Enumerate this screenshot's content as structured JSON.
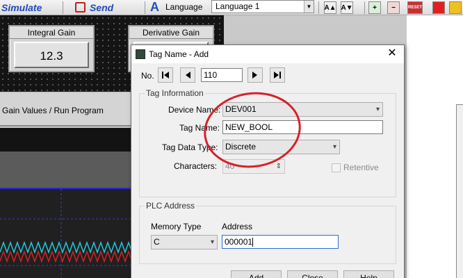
{
  "toolbar": {
    "simulate_label": "Simulate",
    "send_label": "Send",
    "language_label": "Language",
    "language_value": "Language 1",
    "reset_label": "RESET"
  },
  "background": {
    "integral_gain_title": "Integral Gain",
    "integral_gain_value": "12.3",
    "derivative_gain_title": "Derivative Gain",
    "nav_text": "Gain Values  /  Run Program"
  },
  "dialog": {
    "title": "Tag Name - Add",
    "no_label": "No.",
    "no_value": "110",
    "tag_info_title": "Tag Information",
    "device_name_label": "Device Name:",
    "device_name_value": "DEV001",
    "tag_name_label": "Tag Name:",
    "tag_name_value": "NEW_BOOL",
    "tag_data_type_label": "Tag Data Type:",
    "tag_data_type_value": "Discrete",
    "characters_label": "Characters:",
    "characters_value": "40",
    "retentive_label": "Retentive",
    "plc_address_title": "PLC Address",
    "memory_type_label": "Memory Type",
    "memory_type_value": "C",
    "address_label": "Address",
    "address_value": "000001",
    "add_label": "Add",
    "close_label": "Close",
    "help_label": "Help"
  },
  "colors": {
    "annotation": "#d8202a",
    "toolbar_text": "#2148b8"
  }
}
